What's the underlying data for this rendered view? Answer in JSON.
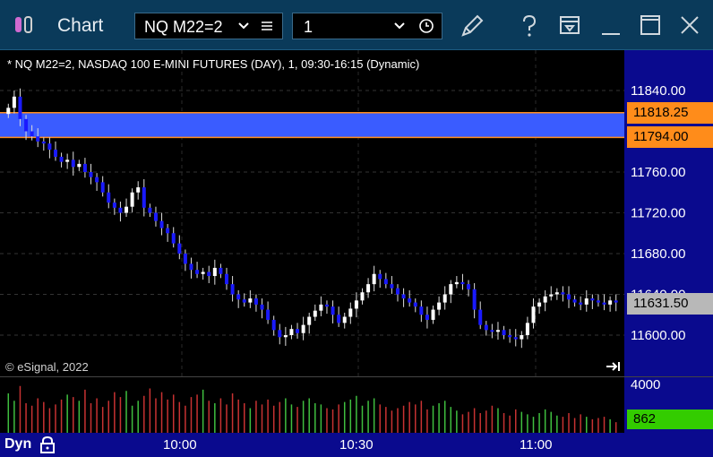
{
  "titlebar": {
    "title": "Chart",
    "symbol": "NQ M22=2",
    "interval": "1"
  },
  "chart": {
    "info_line": "* NQ M22=2, NASDAQ 100 E-MINI FUTURES (DAY), 1, 09:30-16:15 (Dynamic)",
    "copyright": "© eSignal, 2022",
    "price_ticks": [
      "11840.00",
      "11760.00",
      "11720.00",
      "11680.00",
      "11640.00",
      "11600.00"
    ],
    "time_ticks": [
      "10:00",
      "10:30",
      "11:00"
    ],
    "level_high": "11818.25",
    "level_low": "11794.00",
    "last_price": "11631.50",
    "volume_tick": "4000",
    "volume_last": "862",
    "mode_label": "Dyn",
    "colors": {
      "up": "#ffffff",
      "down": "#1a1aff",
      "zone": "#3a5cff",
      "level": "#ff8c1a",
      "volume_up": "#3fbf3f",
      "volume_down": "#c83232",
      "volume_last_bg": "#33cc00",
      "axis_bg": "#0a0a8e",
      "titlebar_bg": "#0a3a5a"
    }
  },
  "chart_data": {
    "type": "candlestick",
    "x_axis_ticks": [
      "10:00",
      "10:30",
      "11:00"
    ],
    "ylim": [
      11570,
      11870
    ],
    "y_ticks": [
      11600,
      11640,
      11680,
      11720,
      11760,
      11840
    ],
    "closes": [
      11823,
      11834,
      11812,
      11800,
      11795,
      11790,
      11788,
      11782,
      11775,
      11770,
      11772,
      11765,
      11768,
      11760,
      11755,
      11750,
      11740,
      11730,
      11725,
      11720,
      11726,
      11740,
      11745,
      11725,
      11720,
      11712,
      11705,
      11700,
      11690,
      11680,
      11670,
      11664,
      11660,
      11662,
      11658,
      11666,
      11660,
      11650,
      11640,
      11635,
      11632,
      11636,
      11630,
      11625,
      11615,
      11605,
      11598,
      11600,
      11606,
      11602,
      11610,
      11618,
      11624,
      11630,
      11628,
      11620,
      11612,
      11618,
      11626,
      11634,
      11642,
      11650,
      11660,
      11655,
      11650,
      11646,
      11640,
      11636,
      11632,
      11628,
      11620,
      11615,
      11625,
      11632,
      11640,
      11650,
      11652,
      11650,
      11645,
      11625,
      11610,
      11605,
      11604,
      11605,
      11600,
      11598,
      11596,
      11600,
      11612,
      11628,
      11632,
      11638,
      11640,
      11642,
      11640,
      11635,
      11632,
      11630,
      11636,
      11634,
      11632,
      11630,
      11634,
      11632
    ],
    "volume": [
      3200,
      2600,
      3800,
      2400,
      2200,
      2800,
      2500,
      2000,
      2300,
      2700,
      3100,
      2900,
      2600,
      3500,
      2400,
      2800,
      2100,
      2600,
      3300,
      2900,
      3400,
      2200,
      2600,
      3000,
      3600,
      2800,
      3300,
      2700,
      3100,
      2500,
      2200,
      2900,
      3100,
      3500,
      2600,
      2400,
      2800,
      2300,
      3200,
      2700,
      2400,
      2000,
      2600,
      2300,
      2700,
      2200,
      2500,
      2800,
      2300,
      2100,
      2600,
      2800,
      2400,
      2300,
      2000,
      1900,
      2300,
      2500,
      2700,
      3000,
      2200,
      2600,
      2800,
      2300,
      2100,
      1800,
      2000,
      2200,
      2500,
      2300,
      2600,
      1900,
      2200,
      2400,
      2600,
      2100,
      1800,
      1500,
      1700,
      2000,
      1600,
      1800,
      2200,
      2000,
      1600,
      1400,
      1900,
      1700,
      1500,
      1300,
      1600,
      1900,
      1700,
      1400,
      1300,
      1600,
      1200,
      1500,
      1300,
      1100,
      1200,
      1300,
      1100,
      862
    ],
    "levels": [
      11818.25,
      11794.0
    ],
    "last_price": 11631.5,
    "volume_ylim": [
      0,
      4000
    ]
  }
}
